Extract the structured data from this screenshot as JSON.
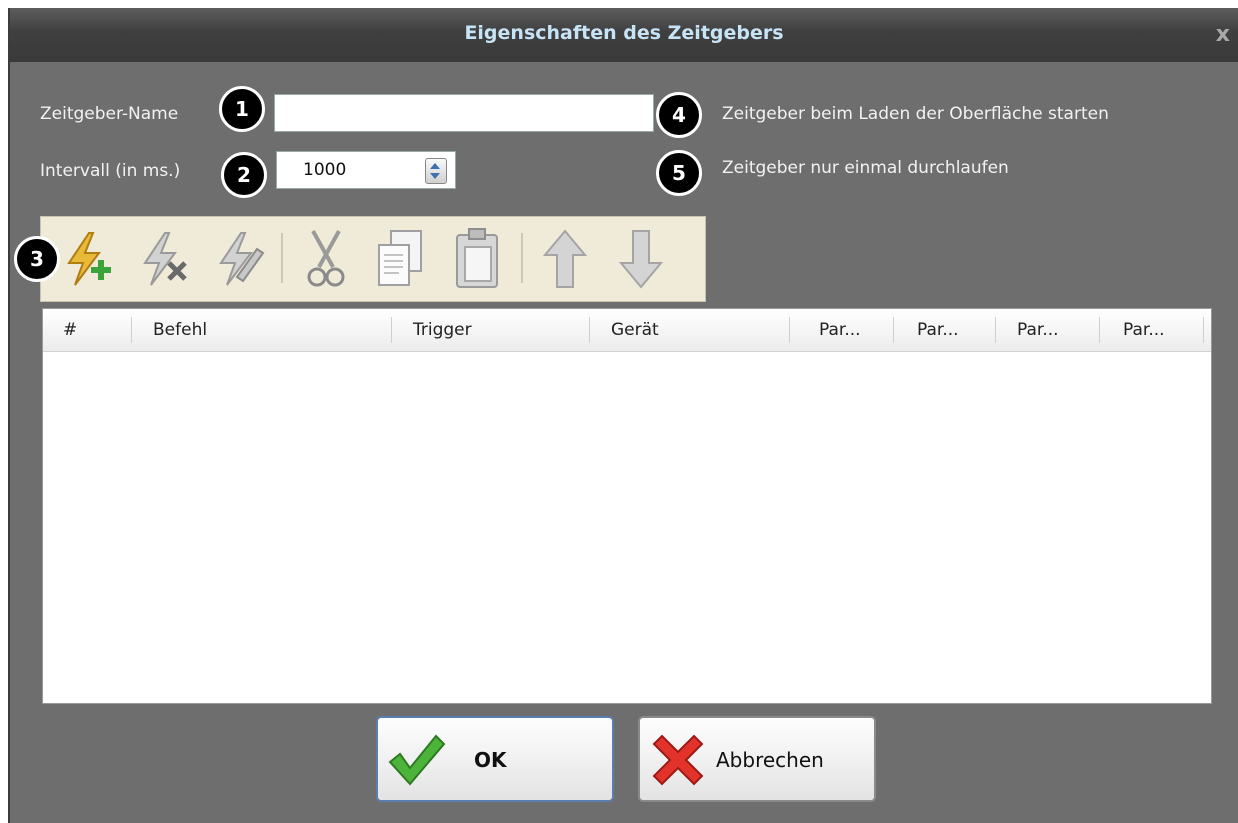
{
  "window": {
    "title": "Eigenschaften des Zeitgebers",
    "close_label": "x"
  },
  "form": {
    "name_label": "Zeitgeber-Name",
    "name_value": "",
    "interval_label": "Intervall (in ms.)",
    "interval_value": "1000",
    "option_start_label": "Zeitgeber beim Laden der Oberfläche starten",
    "option_once_label": "Zeitgeber nur einmal durchlaufen"
  },
  "toolbar": {
    "icons": [
      "add-command-icon",
      "delete-command-icon",
      "edit-command-icon",
      "cut-icon",
      "copy-icon",
      "paste-icon",
      "move-up-icon",
      "move-down-icon"
    ]
  },
  "table": {
    "columns": [
      "#",
      "Befehl",
      "Trigger",
      "Gerät",
      "Par...",
      "Par...",
      "Par...",
      "Par..."
    ],
    "rows": []
  },
  "buttons": {
    "ok_label": "OK",
    "cancel_label": "Abbrechen"
  },
  "markers": [
    "1",
    "2",
    "3",
    "4",
    "5"
  ],
  "colors": {
    "title_text": "#c7e3f6",
    "dialog_bg": "#6e6e6e",
    "toolbar_bg": "#f0ebd8"
  }
}
